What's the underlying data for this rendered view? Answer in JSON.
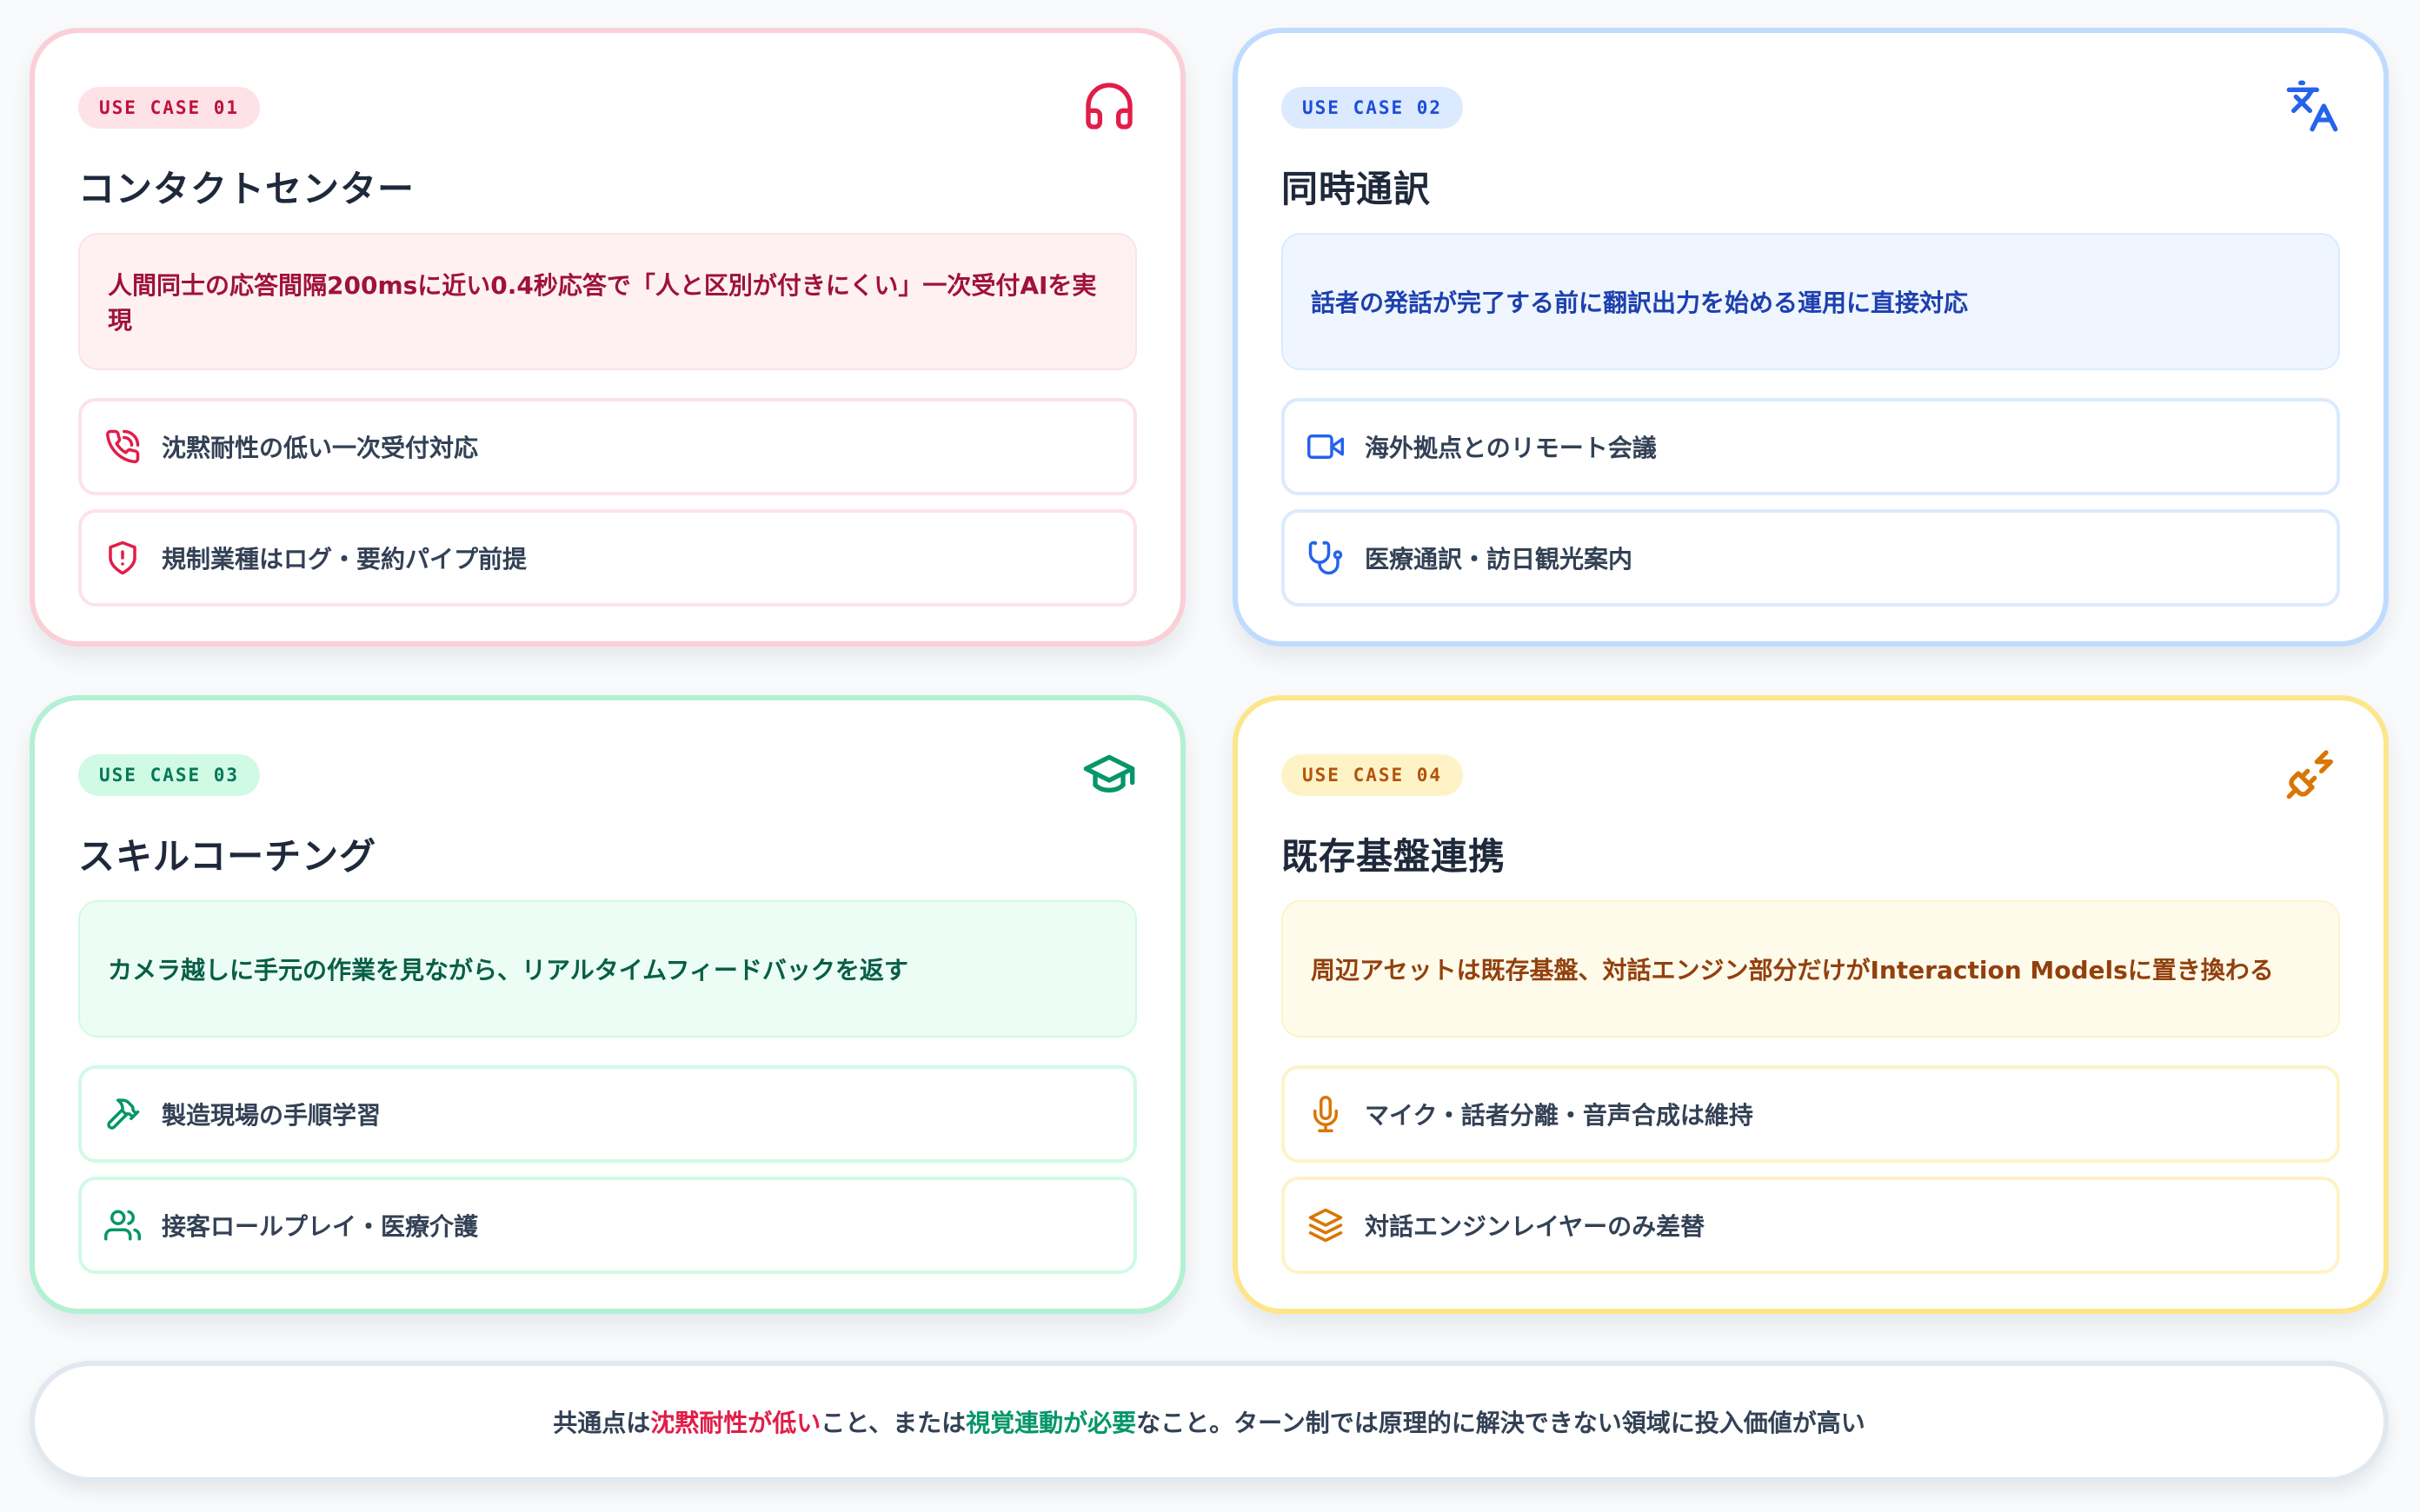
{
  "cards": [
    {
      "badge": "USE CASE 01",
      "icon": "headphones-icon",
      "title": "コンタクトセンター",
      "highlight": "人間同士の応答間隔200msに近い0.4秒応答で「人と区別が付きにくい」一次受付AIを実現",
      "items": [
        {
          "icon": "phone-call-icon",
          "label": "沈黙耐性の低い一次受付対応"
        },
        {
          "icon": "shield-alert-icon",
          "label": "規制業種はログ・要約パイプ前提"
        }
      ],
      "accent": "#e11d48"
    },
    {
      "badge": "USE CASE 02",
      "icon": "translate-icon",
      "title": "同時通訳",
      "highlight": "話者の発話が完了する前に翻訳出力を始める運用に直接対応",
      "items": [
        {
          "icon": "video-camera-icon",
          "label": "海外拠点とのリモート会議"
        },
        {
          "icon": "stethoscope-icon",
          "label": "医療通訳・訪日観光案内"
        }
      ],
      "accent": "#2563eb"
    },
    {
      "badge": "USE CASE 03",
      "icon": "graduation-cap-icon",
      "title": "スキルコーチング",
      "highlight": "カメラ越しに手元の作業を見ながら、リアルタイムフィードバックを返す",
      "items": [
        {
          "icon": "hammer-icon",
          "label": "製造現場の手順学習"
        },
        {
          "icon": "users-icon",
          "label": "接客ロールプレイ・医療介護"
        }
      ],
      "accent": "#059669"
    },
    {
      "badge": "USE CASE 04",
      "icon": "plug-icon",
      "title": "既存基盤連携",
      "highlight": "周辺アセットは既存基盤、対話エンジン部分だけがInteraction Modelsに置き換わる",
      "items": [
        {
          "icon": "microphone-icon",
          "label": "マイク・話者分離・音声合成は維持"
        },
        {
          "icon": "layers-icon",
          "label": "対話エンジンレイヤーのみ差替"
        }
      ],
      "accent": "#d97706"
    }
  ],
  "footer": {
    "part1": "共通点は",
    "highlight1": "沈黙耐性が低い",
    "part2": "こと、または",
    "highlight2": "視覚連動が必要",
    "part3": "なこと。ターン制では原理的に解決できない領域に投入価値が高い"
  }
}
